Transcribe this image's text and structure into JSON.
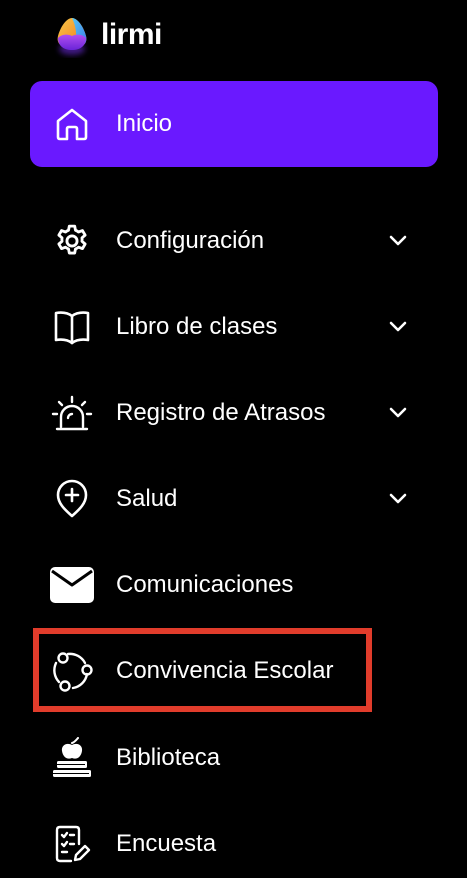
{
  "brand": {
    "name": "lirmi",
    "logo_icon": "lirmi-logo-icon"
  },
  "colors": {
    "background": "#000000",
    "active_item": "#6a19ff",
    "text": "#ffffff",
    "highlight_border": "#e13c2b"
  },
  "sidebar": {
    "items": [
      {
        "label": "Inicio",
        "icon": "home-icon",
        "active": true,
        "expandable": false
      },
      {
        "label": "Configuración",
        "icon": "gear-icon",
        "active": false,
        "expandable": true
      },
      {
        "label": "Libro de clases",
        "icon": "book-icon",
        "active": false,
        "expandable": true
      },
      {
        "label": "Registro de Atrasos",
        "icon": "alarm-siren-icon",
        "active": false,
        "expandable": true
      },
      {
        "label": "Salud",
        "icon": "health-pin-icon",
        "active": false,
        "expandable": true
      },
      {
        "label": "Comunicaciones",
        "icon": "envelope-icon",
        "active": false,
        "expandable": false
      },
      {
        "label": "Convivencia Escolar",
        "icon": "community-cycle-icon",
        "active": false,
        "expandable": false,
        "highlighted": true
      },
      {
        "label": "Biblioteca",
        "icon": "books-apple-icon",
        "active": false,
        "expandable": false
      },
      {
        "label": "Encuesta",
        "icon": "survey-icon",
        "active": false,
        "expandable": false
      }
    ]
  }
}
